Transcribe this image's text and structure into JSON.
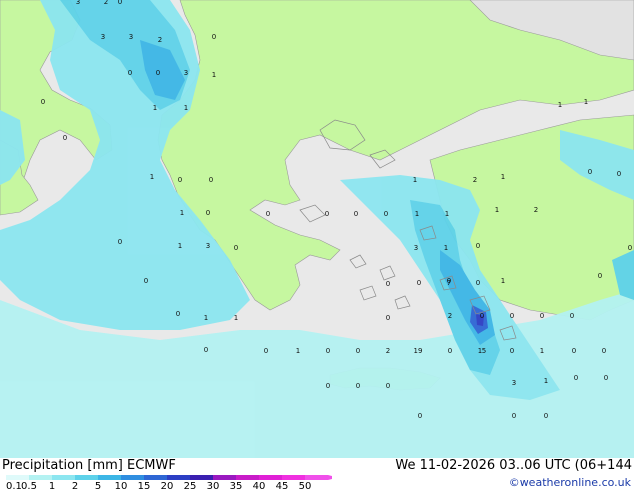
{
  "title": "Precipitation [mm]  ECMWF",
  "datetime": "We 11-02-2026 03..06 UTC (06+144",
  "credit": "©weatheronline.co.uk",
  "legend": {
    "ticks": [
      "0.1",
      "0.5",
      "1",
      "2",
      "5",
      "10",
      "15",
      "20",
      "25",
      "30",
      "35",
      "40",
      "45",
      "50"
    ],
    "colors": [
      "#dffafa",
      "#b4f2f2",
      "#8ce6f0",
      "#5ed2ea",
      "#3cb6e6",
      "#2f8ee0",
      "#2e66d4",
      "#2c3ec4",
      "#3a1fb0",
      "#9a19c0",
      "#c81cc8",
      "#e020d6",
      "#f030e0",
      "#f050ea"
    ]
  },
  "map_labels": [
    {
      "t": "3"
    },
    {
      "t": "2"
    },
    {
      "t": "0"
    },
    {
      "t": "3"
    },
    {
      "t": "3"
    },
    {
      "t": "2"
    },
    {
      "t": "0"
    },
    {
      "t": "0"
    },
    {
      "t": "3"
    },
    {
      "t": "1"
    },
    {
      "t": "0"
    },
    {
      "t": "1"
    },
    {
      "t": "1"
    },
    {
      "t": "0"
    },
    {
      "t": "0"
    },
    {
      "t": "1"
    },
    {
      "t": "0"
    },
    {
      "t": "0"
    },
    {
      "t": "1"
    },
    {
      "t": "0"
    },
    {
      "t": "1"
    },
    {
      "t": "3"
    },
    {
      "t": "0"
    },
    {
      "t": "0"
    },
    {
      "t": "0"
    },
    {
      "t": "0"
    },
    {
      "t": "0"
    },
    {
      "t": "1"
    },
    {
      "t": "1"
    },
    {
      "t": "1"
    },
    {
      "t": "2"
    },
    {
      "t": "1"
    },
    {
      "t": "1"
    },
    {
      "t": "2"
    },
    {
      "t": "1"
    },
    {
      "t": "1"
    },
    {
      "t": "0"
    },
    {
      "t": "0"
    },
    {
      "t": "1"
    },
    {
      "t": "1"
    },
    {
      "t": "0"
    },
    {
      "t": "0"
    },
    {
      "t": "0"
    },
    {
      "t": "3"
    },
    {
      "t": "1"
    },
    {
      "t": "0"
    },
    {
      "t": "0"
    },
    {
      "t": "0"
    },
    {
      "t": "0"
    },
    {
      "t": "1"
    },
    {
      "t": "7"
    },
    {
      "t": "0"
    },
    {
      "t": "0"
    },
    {
      "t": "0"
    },
    {
      "t": "0"
    },
    {
      "t": "1"
    },
    {
      "t": "0"
    },
    {
      "t": "0"
    },
    {
      "t": "2"
    },
    {
      "t": "19"
    },
    {
      "t": "2"
    },
    {
      "t": "0"
    },
    {
      "t": "0"
    },
    {
      "t": "0"
    },
    {
      "t": "0"
    },
    {
      "t": "0"
    },
    {
      "t": "0"
    },
    {
      "t": "0"
    },
    {
      "t": "1"
    },
    {
      "t": "0"
    },
    {
      "t": "1"
    },
    {
      "t": "5"
    },
    {
      "t": "0"
    },
    {
      "t": "0"
    },
    {
      "t": "0"
    },
    {
      "t": "0"
    },
    {
      "t": "0"
    },
    {
      "t": "3"
    },
    {
      "t": "1"
    },
    {
      "t": "0"
    },
    {
      "t": "0"
    },
    {
      "t": "0"
    },
    {
      "t": "0"
    },
    {
      "t": "0"
    }
  ]
}
